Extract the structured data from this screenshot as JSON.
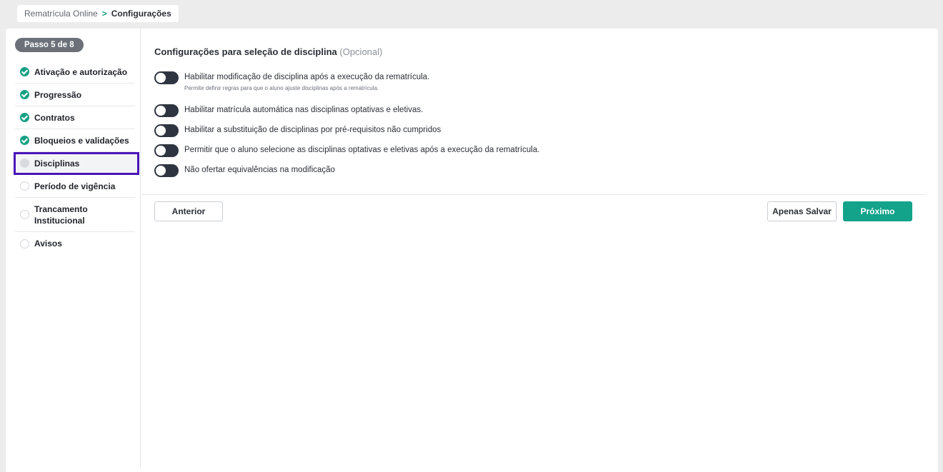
{
  "breadcrumb": {
    "parent": "Rematrícula Online",
    "separator": ">",
    "current": "Configurações"
  },
  "sidebar": {
    "step_badge": "Passo 5 de 8",
    "steps": [
      {
        "label": "Ativação e autorização",
        "status": "done"
      },
      {
        "label": "Progressão",
        "status": "done"
      },
      {
        "label": "Contratos",
        "status": "done"
      },
      {
        "label": "Bloqueios e validações",
        "status": "done"
      },
      {
        "label": "Disciplinas",
        "status": "current"
      },
      {
        "label": "Período de vigência",
        "status": "todo"
      },
      {
        "label": "Trancamento Institucional",
        "status": "todo"
      },
      {
        "label": "Avisos",
        "status": "todo"
      }
    ]
  },
  "main": {
    "title": "Configurações para seleção de disciplina",
    "title_optional": "(Opcional)",
    "toggles": [
      {
        "label": "Habilitar modificação de disciplina após a execução da rematrícula.",
        "help": "Permite definir regras para que o aluno ajuste disciplinas após a rematrícula.",
        "checked": false
      },
      {
        "label": "Habilitar matrícula automática nas disciplinas optativas e eletivas.",
        "checked": false
      },
      {
        "label": "Habilitar a substituição de disciplinas por pré-requisitos não cumpridos",
        "checked": false
      },
      {
        "label": "Permitir que o aluno selecione as disciplinas optativas e eletivas após a execução da rematrícula.",
        "checked": false
      },
      {
        "label": "Não ofertar equivalências na modificação",
        "checked": false
      }
    ]
  },
  "footer": {
    "back_label": "Anterior",
    "save_label": "Apenas Salvar",
    "next_label": "Próximo"
  },
  "colors": {
    "accent": "#12a38a",
    "active_outline": "#4a16b8",
    "toggle_off": "#2f3540"
  }
}
